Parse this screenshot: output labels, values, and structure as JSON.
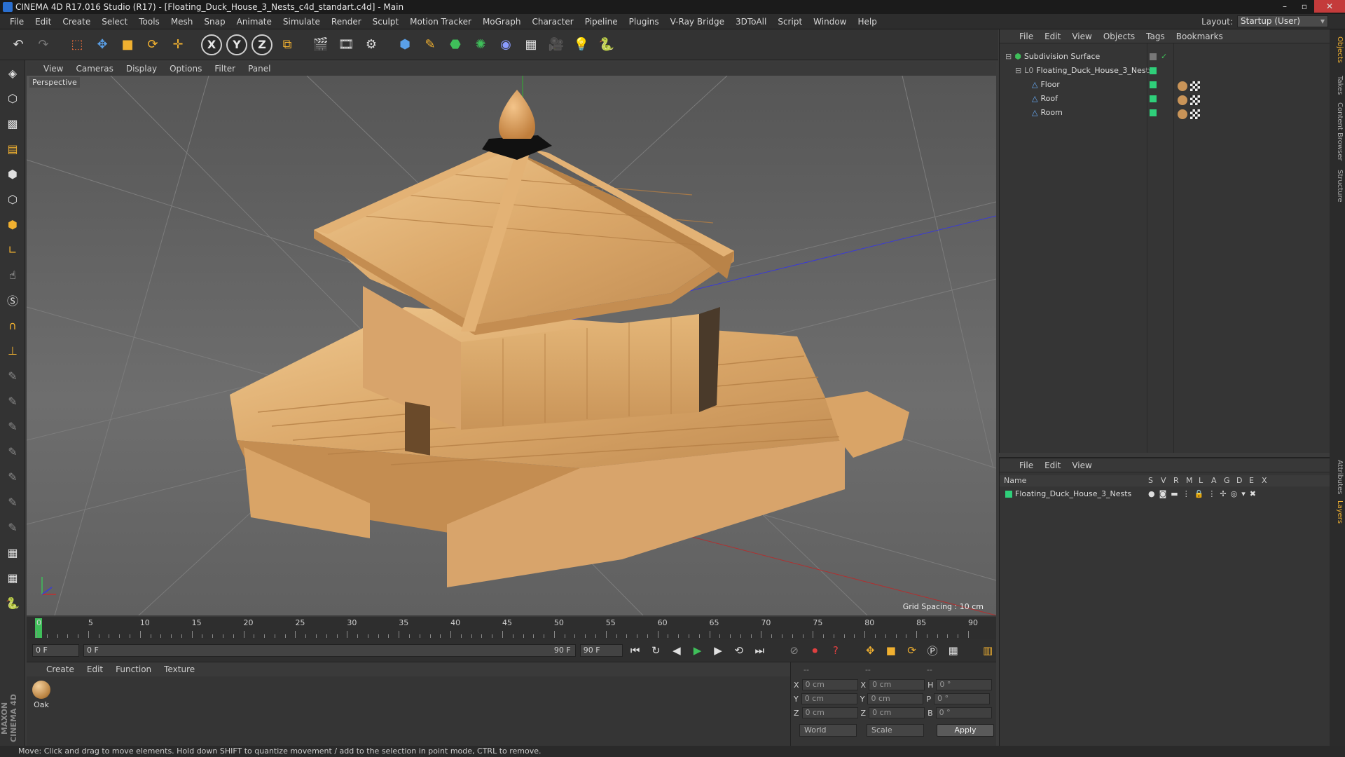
{
  "titlebar": {
    "title": "CINEMA 4D R17.016 Studio (R17) - [Floating_Duck_House_3_Nests_c4d_standart.c4d] - Main"
  },
  "menu": [
    "File",
    "Edit",
    "Create",
    "Select",
    "Tools",
    "Mesh",
    "Snap",
    "Animate",
    "Simulate",
    "Render",
    "Sculpt",
    "Motion Tracker",
    "MoGraph",
    "Character",
    "Pipeline",
    "Plugins",
    "V-Ray Bridge",
    "3DToAll",
    "Script",
    "Window",
    "Help"
  ],
  "layout": {
    "label": "Layout:",
    "value": "Startup (User)"
  },
  "toolbar": {
    "axis_x": "X",
    "axis_y": "Y",
    "axis_z": "Z"
  },
  "viewport": {
    "menu": [
      "View",
      "Cameras",
      "Display",
      "Options",
      "Filter",
      "Panel"
    ],
    "label": "Perspective",
    "grid_spacing": "Grid Spacing : 10 cm"
  },
  "timeline": {
    "frames": [
      "0",
      "5",
      "10",
      "15",
      "20",
      "25",
      "30",
      "35",
      "40",
      "45",
      "50",
      "55",
      "60",
      "65",
      "70",
      "75",
      "80",
      "85",
      "90"
    ],
    "current": "0 F",
    "start": "0 F",
    "range_start": "0 F",
    "range_end": "90 F",
    "end": "90 F"
  },
  "material_panel": {
    "menu": [
      "Create",
      "Edit",
      "Function",
      "Texture"
    ],
    "materials": [
      {
        "label": "Oak"
      }
    ]
  },
  "coords": {
    "header": [
      "--",
      "--",
      "--"
    ],
    "rows": [
      {
        "a": "X",
        "av": "0 cm",
        "b": "X",
        "bv": "0 cm",
        "c": "H",
        "cv": "0 °"
      },
      {
        "a": "Y",
        "av": "0 cm",
        "b": "Y",
        "bv": "0 cm",
        "c": "P",
        "cv": "0 °"
      },
      {
        "a": "Z",
        "av": "0 cm",
        "b": "Z",
        "bv": "0 cm",
        "c": "B",
        "cv": "0 °"
      }
    ],
    "space": "World",
    "mode": "Scale",
    "apply": "Apply"
  },
  "status": "Move: Click and drag to move elements. Hold down SHIFT to quantize movement / add to the selection in point mode, CTRL to remove.",
  "objects_panel": {
    "menu": [
      "File",
      "Edit",
      "View",
      "Objects",
      "Tags",
      "Bookmarks"
    ],
    "items": [
      {
        "name": "Subdivision Surface",
        "indent": 0
      },
      {
        "name": "Floating_Duck_House_3_Nests",
        "indent": 1
      },
      {
        "name": "Floor",
        "indent": 2
      },
      {
        "name": "Roof",
        "indent": 2
      },
      {
        "name": "Room",
        "indent": 2
      }
    ]
  },
  "layers_panel": {
    "menu": [
      "File",
      "Edit",
      "View"
    ],
    "col_name": "Name",
    "cols": [
      "S",
      "V",
      "R",
      "M",
      "L",
      "A",
      "G",
      "D",
      "E",
      "X"
    ],
    "items": [
      {
        "name": "Floating_Duck_House_3_Nests"
      }
    ]
  },
  "right_tabs": [
    "Objects",
    "Takes",
    "Content Browser",
    "Structure",
    "Attributes",
    "Layers"
  ],
  "maxon": "MAXON CINEMA 4D",
  "colors": {
    "accent_green": "#3fbf5a",
    "layer_color": "#2fcf7a",
    "wood": "#d9a86b"
  }
}
